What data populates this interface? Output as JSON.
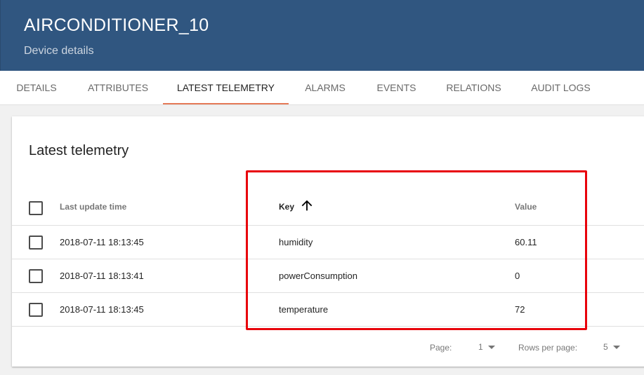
{
  "header": {
    "title": "AIRCONDITIONER_10",
    "subtitle": "Device details"
  },
  "tabs": [
    {
      "label": "DETAILS"
    },
    {
      "label": "ATTRIBUTES"
    },
    {
      "label": "LATEST TELEMETRY",
      "active": true
    },
    {
      "label": "ALARMS"
    },
    {
      "label": "EVENTS"
    },
    {
      "label": "RELATIONS"
    },
    {
      "label": "AUDIT LOGS"
    }
  ],
  "card": {
    "title": "Latest telemetry",
    "columns": {
      "last_update_time": "Last update time",
      "key": "Key",
      "value": "Value"
    },
    "sort_icon": "arrow-upward-icon",
    "rows": [
      {
        "time": "2018-07-11 18:13:45",
        "key": "humidity",
        "value": "60.11"
      },
      {
        "time": "2018-07-11 18:13:41",
        "key": "powerConsumption",
        "value": "0"
      },
      {
        "time": "2018-07-11 18:13:45",
        "key": "temperature",
        "value": "72"
      }
    ],
    "pagination": {
      "page_label": "Page:",
      "page_value": "1",
      "rows_per_page_label": "Rows per page:",
      "rows_per_page_value": "5"
    }
  },
  "colors": {
    "header_bg": "#305680",
    "tab_ink": "#e57a57",
    "highlight_border": "#e8000b"
  }
}
